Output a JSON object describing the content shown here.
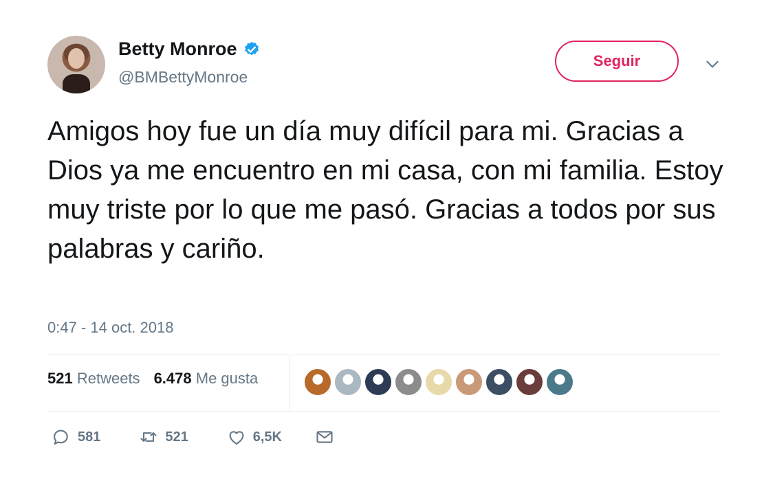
{
  "user": {
    "display_name": "Betty Monroe",
    "handle": "@BMBettyMonroe",
    "verified": true
  },
  "follow_button": {
    "label": "Seguir",
    "color": "#e0245e"
  },
  "tweet": {
    "text": "Amigos hoy fue un día muy difícil para mi. Gracias a Dios ya me encuentro en mi casa, con mi familia. Estoy muy triste por lo que me pasó. Gracias a todos por sus palabras y cariño.",
    "timestamp": "0:47 - 14 oct. 2018"
  },
  "stats": {
    "retweets_count": "521",
    "retweets_label": "Retweets",
    "likes_count": "6.478",
    "likes_label": "Me gusta"
  },
  "liker_avatars": [
    {
      "name": "liker-1",
      "color": "#b86a2a"
    },
    {
      "name": "liker-2",
      "color": "#aab8c2"
    },
    {
      "name": "liker-3",
      "color": "#2e3b55"
    },
    {
      "name": "liker-4",
      "color": "#8c8c8c"
    },
    {
      "name": "liker-5",
      "color": "#e8d9a8"
    },
    {
      "name": "liker-6",
      "color": "#c89a78"
    },
    {
      "name": "liker-7",
      "color": "#3c4d64"
    },
    {
      "name": "liker-8",
      "color": "#6b3c3c"
    },
    {
      "name": "liker-9",
      "color": "#4a7a8a"
    }
  ],
  "actions": {
    "reply_count": "581",
    "retweet_count": "521",
    "like_count": "6,5K"
  },
  "icons": {
    "verified": "verified-badge-icon",
    "caret": "chevron-down-icon",
    "reply": "reply-bubble-icon",
    "retweet": "retweet-arrows-icon",
    "like": "heart-icon",
    "dm": "envelope-icon"
  },
  "colors": {
    "text": "#14171a",
    "secondary": "#657786",
    "verified": "#1da1f2",
    "divider": "#e6ecf0"
  }
}
